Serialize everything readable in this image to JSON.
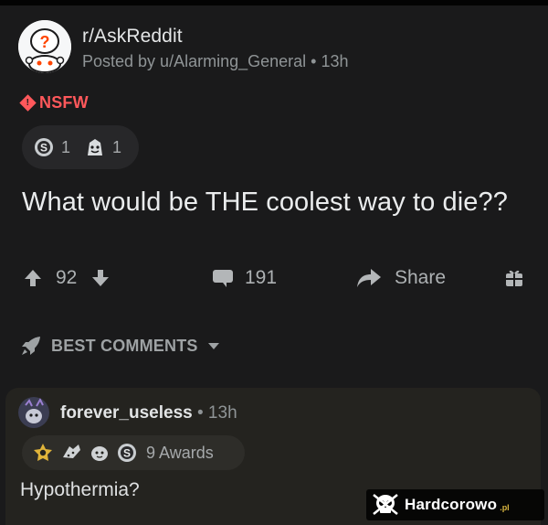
{
  "post": {
    "subreddit": "r/AskReddit",
    "posted_by": "Posted by u/Alarming_General • 13h",
    "nsfw_label": "NSFW",
    "awards": [
      {
        "icon": "silver-award-icon",
        "count": "1"
      },
      {
        "icon": "wholesome-award-icon",
        "count": "1"
      }
    ],
    "title": "What would be THE coolest way to die??",
    "upvotes": "92",
    "comments": "191",
    "share_label": "Share"
  },
  "sort": {
    "label": "BEST COMMENTS"
  },
  "comment": {
    "username": "forever_useless",
    "time": "• 13h",
    "awards_label": "9 Awards",
    "body": "Hypothermia?"
  },
  "watermark": {
    "name": "Hardcorowo",
    "tld": ".pl"
  },
  "colors": {
    "background": "#1a1a1b",
    "nsfw": "#ff585b",
    "comment_card": "#24231f"
  }
}
